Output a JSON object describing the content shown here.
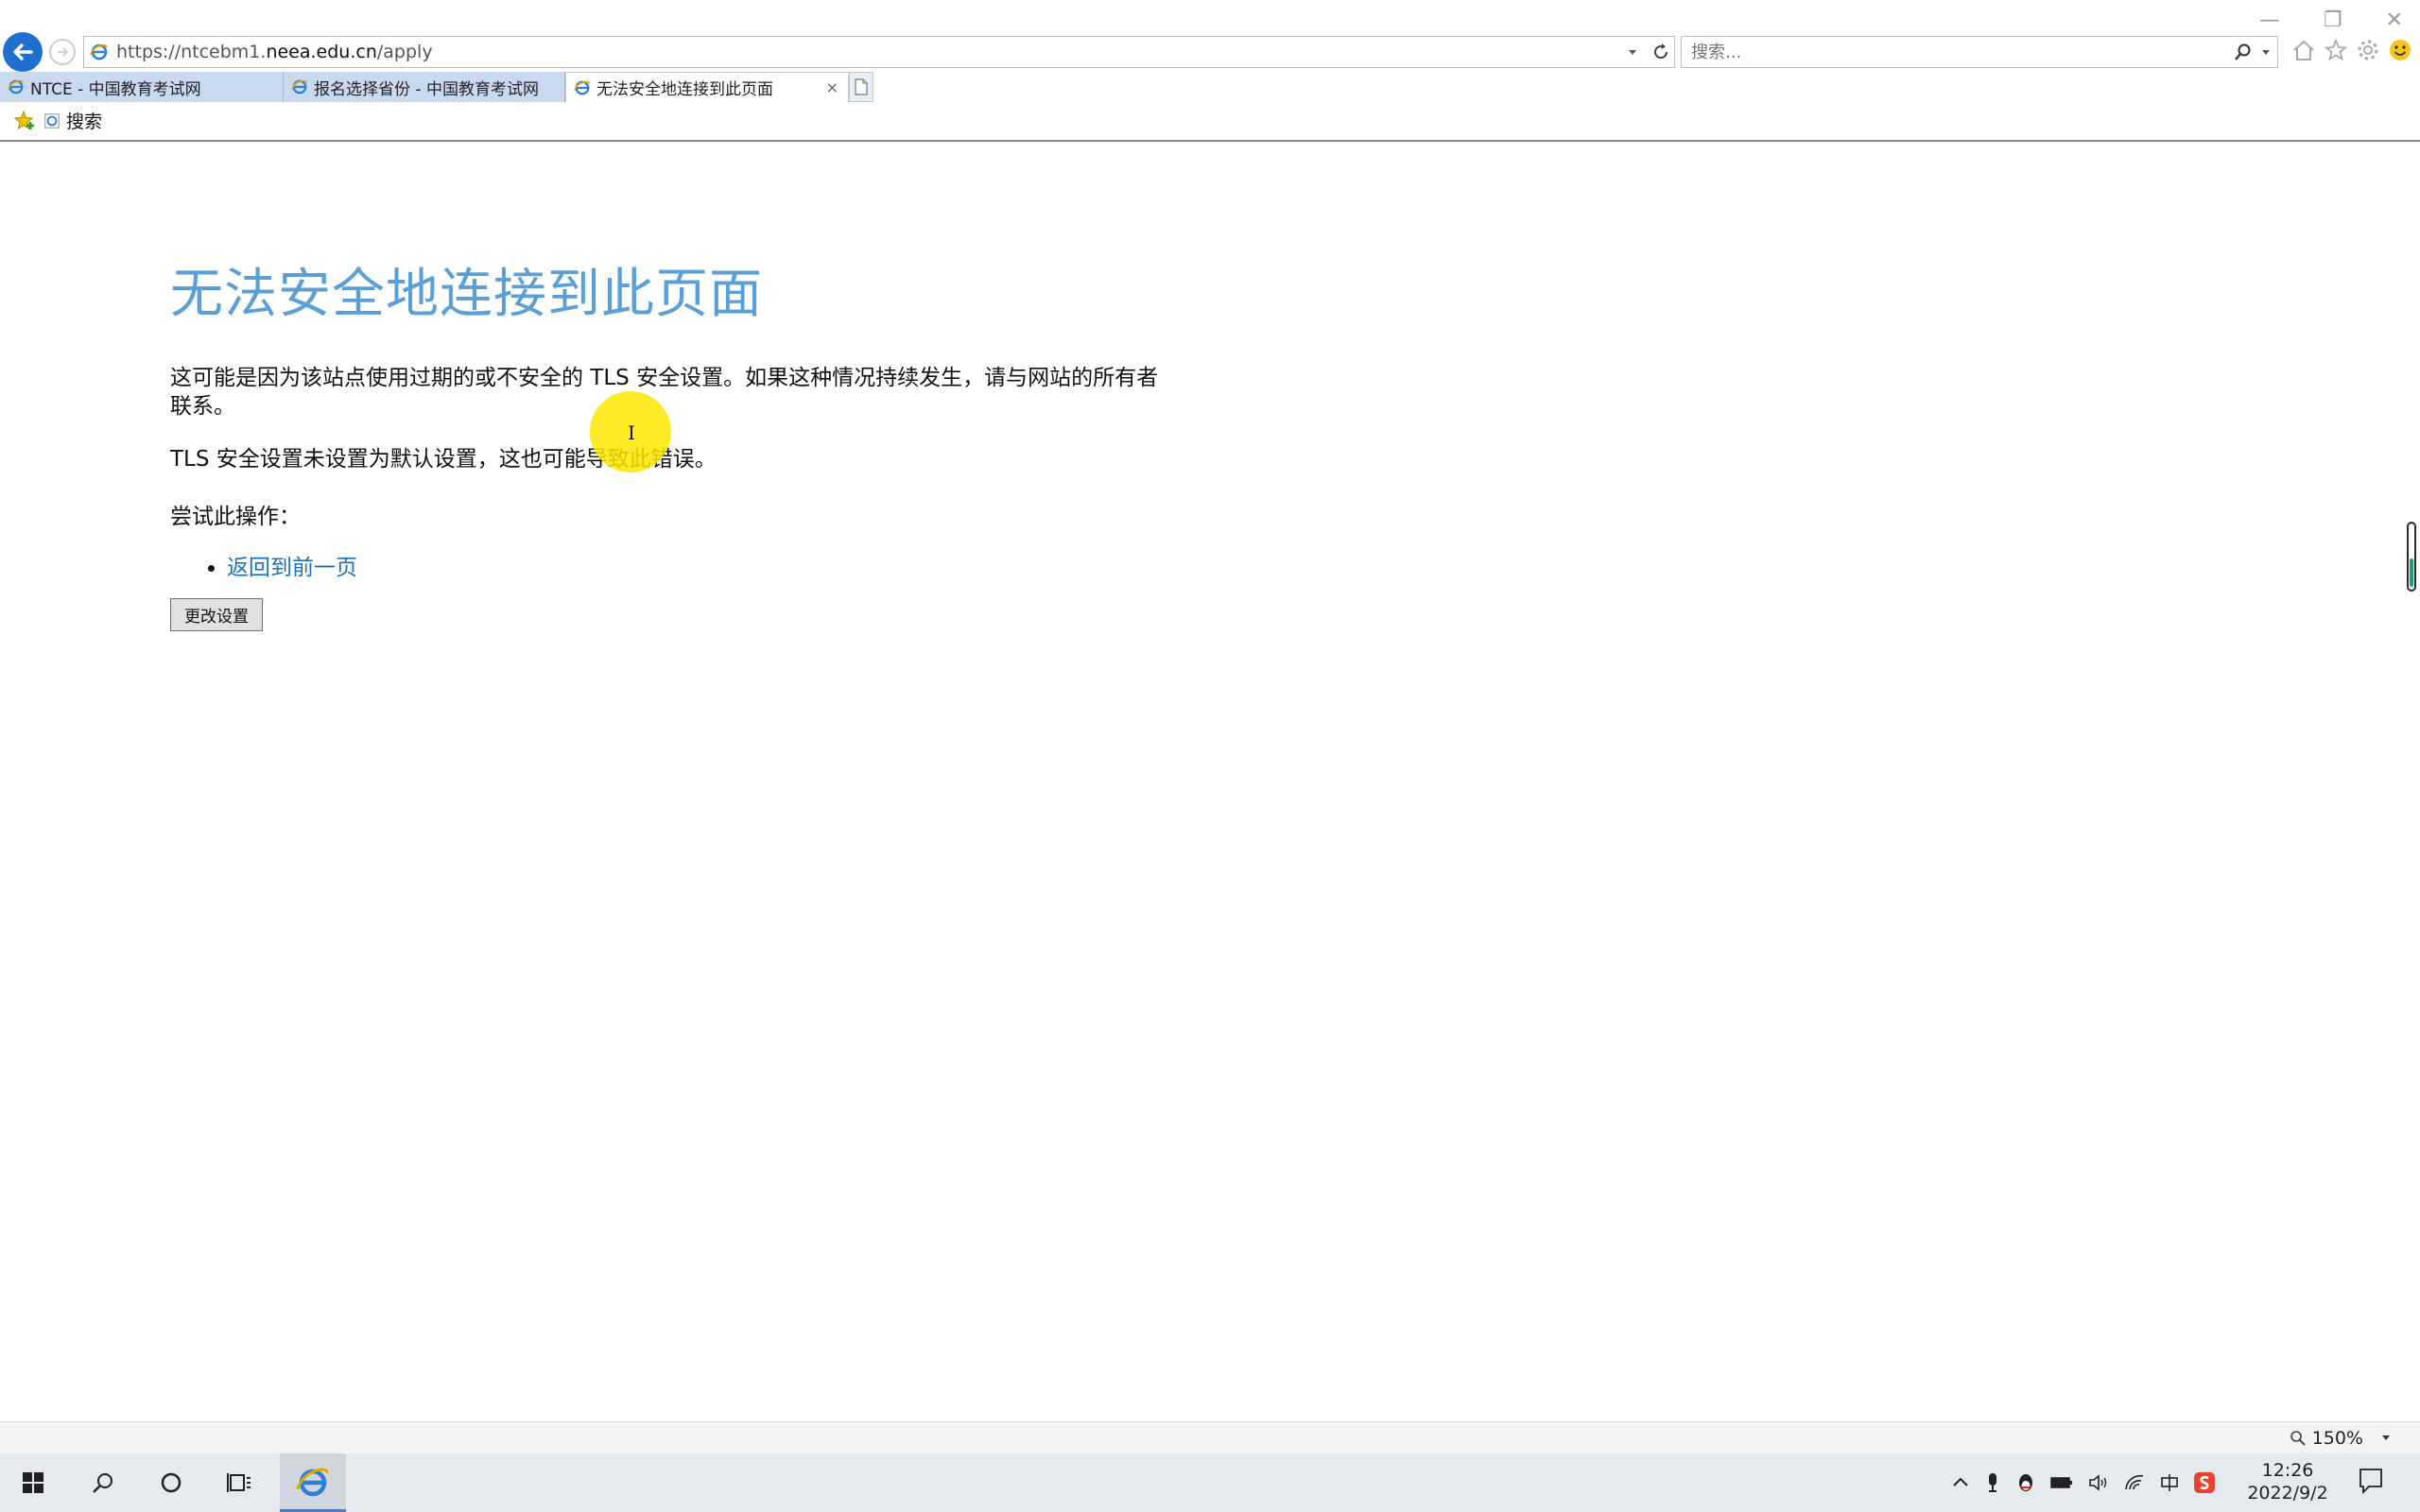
{
  "window": {
    "controls": [
      "—",
      "❐",
      "✕"
    ]
  },
  "address_bar": {
    "url_prefix": "https://ntcebm1.",
    "url_domain": "neea.edu.cn",
    "url_path": "/apply"
  },
  "search": {
    "placeholder": "搜索..."
  },
  "tabs": [
    {
      "label": "NTCE - 中国教育考试网",
      "active": false
    },
    {
      "label": "报名选择省份 - 中国教育考试网",
      "active": false
    },
    {
      "label": "无法安全地连接到此页面",
      "active": true,
      "close": "×"
    }
  ],
  "favorites_bar": {
    "items": [
      {
        "label": "搜索"
      }
    ]
  },
  "page": {
    "title": "无法安全地连接到此页面",
    "paragraph1": "这可能是因为该站点使用过期的或不安全的 TLS 安全设置。如果这种情况持续发生，请与网站的所有者联系。",
    "paragraph2": "TLS 安全设置未设置为默认设置，这也可能导致此错误。",
    "try_label": "尝试此操作：",
    "actions": [
      {
        "label": "返回到前一页"
      }
    ],
    "button_label": "更改设置"
  },
  "status_bar": {
    "zoom": "150%"
  },
  "taskbar": {
    "clock_time": "12:26",
    "clock_date": "2022/9/2"
  },
  "colors": {
    "title_blue": "#5a9fd6",
    "link_blue": "#1a73b8",
    "back_button": "#1f6fd0",
    "inactive_tab": "#c9d9ef"
  }
}
